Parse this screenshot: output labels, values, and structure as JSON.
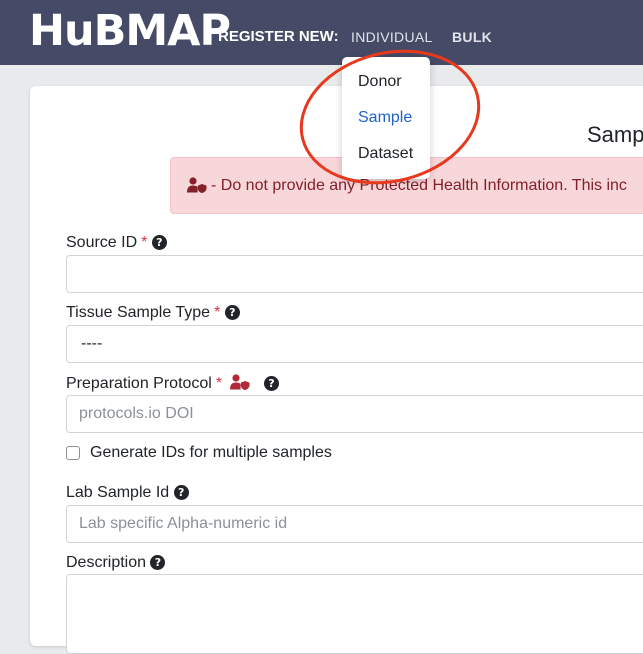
{
  "navbar": {
    "logo": "HuBMAP",
    "register_label": "REGISTER NEW:",
    "links": [
      {
        "label": "INDIVIDUAL"
      },
      {
        "label": "BULK"
      }
    ]
  },
  "dropdown": {
    "items": [
      {
        "label": "Donor"
      },
      {
        "label": "Sample"
      },
      {
        "label": "Dataset"
      }
    ],
    "active_index": 1
  },
  "form": {
    "title": "Samp",
    "phi_alert": "- Do not provide any Protected Health Information. This inc",
    "source_id": {
      "label": "Source ID",
      "required_mark": "*",
      "value": ""
    },
    "tissue_sample_type": {
      "label": "Tissue Sample Type",
      "required_mark": "*",
      "value": "----"
    },
    "preparation_protocol": {
      "label": "Preparation Protocol",
      "required_mark": "*",
      "placeholder": "protocols.io DOI"
    },
    "generate_ids": {
      "label": "Generate IDs for multiple samples",
      "checked": false
    },
    "lab_sample_id": {
      "label": "Lab Sample Id",
      "placeholder": "Lab specific Alpha-numeric id"
    },
    "description": {
      "label": "Description"
    },
    "help_glyph": "?"
  },
  "colors": {
    "navbar_bg": "#454b67",
    "alert_bg": "#f8d7da",
    "alert_text": "#842029",
    "required": "#dc3545",
    "active_link": "#1c64c9",
    "annotation_circle": "#e8391f"
  },
  "icons": {
    "phi": "user-shield-icon",
    "help": "question-circle-icon"
  }
}
